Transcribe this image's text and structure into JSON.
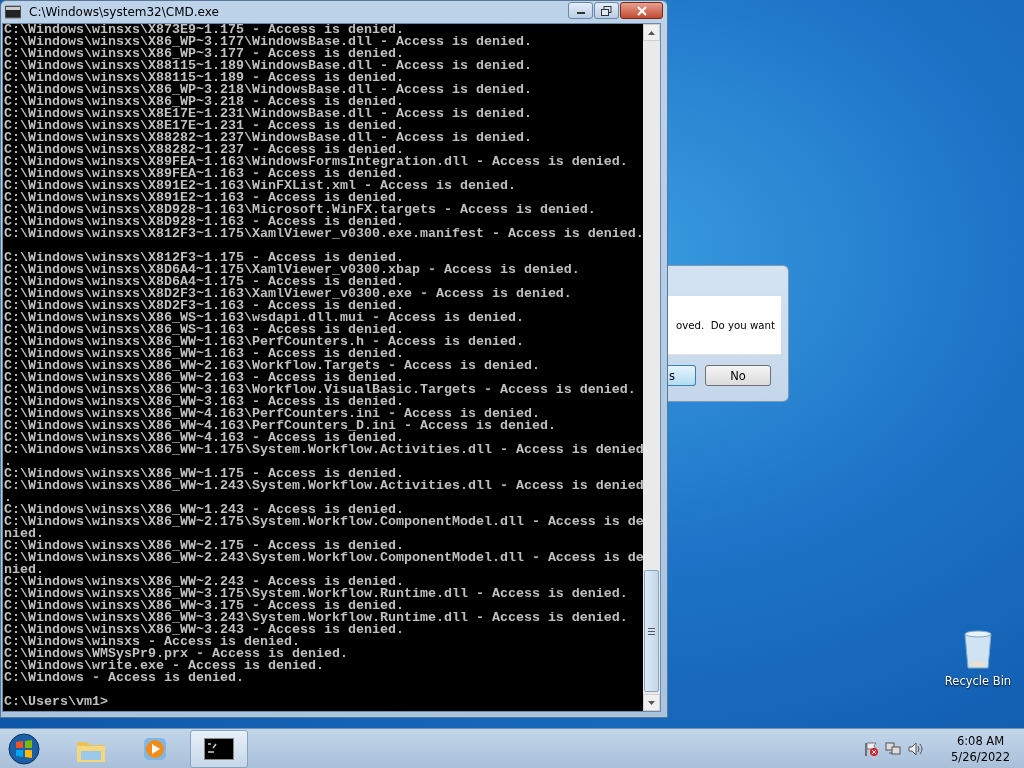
{
  "console_window": {
    "title": "C:\\Windows\\system32\\CMD.exe",
    "lines": [
      {
        "kind": "text",
        "text": "C:\\Windows\\winsxs\\X873E9~1.175 - Access is denied."
      },
      {
        "kind": "text",
        "text": "C:\\Windows\\winsxs\\X86_WP~3.177\\WindowsBase.dll - Access is denied."
      },
      {
        "kind": "text",
        "text": "C:\\Windows\\winsxs\\X86_WP~3.177 - Access is denied."
      },
      {
        "kind": "text",
        "text": "C:\\Windows\\winsxs\\X88115~1.189\\WindowsBase.dll - Access is denied."
      },
      {
        "kind": "text",
        "text": "C:\\Windows\\winsxs\\X88115~1.189 - Access is denied."
      },
      {
        "kind": "text",
        "text": "C:\\Windows\\winsxs\\X86_WP~3.218\\WindowsBase.dll - Access is denied."
      },
      {
        "kind": "text",
        "text": "C:\\Windows\\winsxs\\X86_WP~3.218 - Access is denied."
      },
      {
        "kind": "text",
        "text": "C:\\Windows\\winsxs\\X8E17E~1.231\\WindowsBase.dll - Access is denied."
      },
      {
        "kind": "text",
        "text": "C:\\Windows\\winsxs\\X8E17E~1.231 - Access is denied."
      },
      {
        "kind": "text",
        "text": "C:\\Windows\\winsxs\\X88282~1.237\\WindowsBase.dll - Access is denied."
      },
      {
        "kind": "text",
        "text": "C:\\Windows\\winsxs\\X88282~1.237 - Access is denied."
      },
      {
        "kind": "text",
        "text": "C:\\Windows\\winsxs\\X89FEA~1.163\\WindowsFormsIntegration.dll - Access is denied."
      },
      {
        "kind": "text",
        "text": "C:\\Windows\\winsxs\\X89FEA~1.163 - Access is denied."
      },
      {
        "kind": "text",
        "text": "C:\\Windows\\winsxs\\X891E2~1.163\\WinFXList.xml - Access is denied."
      },
      {
        "kind": "text",
        "text": "C:\\Windows\\winsxs\\X891E2~1.163 - Access is denied."
      },
      {
        "kind": "text",
        "text": "C:\\Windows\\winsxs\\X8D928~1.163\\Microsoft.WinFX.targets - Access is denied."
      },
      {
        "kind": "text",
        "text": "C:\\Windows\\winsxs\\X8D928~1.163 - Access is denied."
      },
      {
        "kind": "text",
        "text": "C:\\Windows\\winsxs\\X812F3~1.175\\XamlViewer_v0300.exe.manifest - Access is denied."
      },
      {
        "kind": "blank"
      },
      {
        "kind": "text",
        "text": "C:\\Windows\\winsxs\\X812F3~1.175 - Access is denied."
      },
      {
        "kind": "text",
        "text": "C:\\Windows\\winsxs\\X8D6A4~1.175\\XamlViewer_v0300.xbap - Access is denied."
      },
      {
        "kind": "text",
        "text": "C:\\Windows\\winsxs\\X8D6A4~1.175 - Access is denied."
      },
      {
        "kind": "text",
        "text": "C:\\Windows\\winsxs\\X8D2F3~1.163\\XamlViewer_v0300.exe - Access is denied."
      },
      {
        "kind": "text",
        "text": "C:\\Windows\\winsxs\\X8D2F3~1.163 - Access is denied."
      },
      {
        "kind": "text",
        "text": "C:\\Windows\\winsxs\\X86_WS~1.163\\wsdapi.dll.mui - Access is denied."
      },
      {
        "kind": "text",
        "text": "C:\\Windows\\winsxs\\X86_WS~1.163 - Access is denied."
      },
      {
        "kind": "text",
        "text": "C:\\Windows\\winsxs\\X86_WW~1.163\\PerfCounters.h - Access is denied."
      },
      {
        "kind": "text",
        "text": "C:\\Windows\\winsxs\\X86_WW~1.163 - Access is denied."
      },
      {
        "kind": "text",
        "text": "C:\\Windows\\winsxs\\X86_WW~2.163\\Workflow.Targets - Access is denied."
      },
      {
        "kind": "text",
        "text": "C:\\Windows\\winsxs\\X86_WW~2.163 - Access is denied."
      },
      {
        "kind": "text",
        "text": "C:\\Windows\\winsxs\\X86_WW~3.163\\Workflow.VisualBasic.Targets - Access is denied."
      },
      {
        "kind": "text",
        "text": "C:\\Windows\\winsxs\\X86_WW~3.163 - Access is denied."
      },
      {
        "kind": "text",
        "text": "C:\\Windows\\winsxs\\X86_WW~4.163\\PerfCounters.ini - Access is denied."
      },
      {
        "kind": "text",
        "text": "C:\\Windows\\winsxs\\X86_WW~4.163\\PerfCounters_D.ini - Access is denied."
      },
      {
        "kind": "text",
        "text": "C:\\Windows\\winsxs\\X86_WW~4.163 - Access is denied."
      },
      {
        "kind": "text",
        "text": "C:\\Windows\\winsxs\\X86_WW~1.175\\System.Workflow.Activities.dll - Access is denied"
      },
      {
        "kind": "text",
        "text": "."
      },
      {
        "kind": "text",
        "text": "C:\\Windows\\winsxs\\X86_WW~1.175 - Access is denied."
      },
      {
        "kind": "text",
        "text": "C:\\Windows\\winsxs\\X86_WW~1.243\\System.Workflow.Activities.dll - Access is denied"
      },
      {
        "kind": "text",
        "text": "."
      },
      {
        "kind": "text",
        "text": "C:\\Windows\\winsxs\\X86_WW~1.243 - Access is denied."
      },
      {
        "kind": "text",
        "text": "C:\\Windows\\winsxs\\X86_WW~2.175\\System.Workflow.ComponentModel.dll - Access is de"
      },
      {
        "kind": "text",
        "text": "nied."
      },
      {
        "kind": "text",
        "text": "C:\\Windows\\winsxs\\X86_WW~2.175 - Access is denied."
      },
      {
        "kind": "text",
        "text": "C:\\Windows\\winsxs\\X86_WW~2.243\\System.Workflow.ComponentModel.dll - Access is de"
      },
      {
        "kind": "text",
        "text": "nied."
      },
      {
        "kind": "text",
        "text": "C:\\Windows\\winsxs\\X86_WW~2.243 - Access is denied."
      },
      {
        "kind": "text",
        "text": "C:\\Windows\\winsxs\\X86_WW~3.175\\System.Workflow.Runtime.dll - Access is denied."
      },
      {
        "kind": "text",
        "text": "C:\\Windows\\winsxs\\X86_WW~3.175 - Access is denied."
      },
      {
        "kind": "text",
        "text": "C:\\Windows\\winsxs\\X86_WW~3.243\\System.Workflow.Runtime.dll - Access is denied."
      },
      {
        "kind": "text",
        "text": "C:\\Windows\\winsxs\\X86_WW~3.243 - Access is denied."
      },
      {
        "kind": "text",
        "text": "C:\\Windows\\winsxs - Access is denied."
      },
      {
        "kind": "text",
        "text": "C:\\Windows\\WMSysPr9.prx - Access is denied."
      },
      {
        "kind": "text",
        "text": "C:\\Windows\\write.exe - Access is denied."
      },
      {
        "kind": "text",
        "text": "C:\\Windows - Access is denied."
      },
      {
        "kind": "blank"
      },
      {
        "kind": "prompt",
        "text": "C:\\Users\\vm1>"
      }
    ]
  },
  "dialog": {
    "message": "oved.  Do you want",
    "buttons": [
      {
        "label": "s",
        "selected": true
      },
      {
        "label": "No",
        "selected": false
      }
    ]
  },
  "desktop_icons": [
    {
      "label": "Recycle Bin"
    }
  ],
  "taskbar": {
    "buttons": [
      {
        "kind": "folder",
        "selected": false
      },
      {
        "kind": "media",
        "selected": false
      },
      {
        "kind": "console",
        "selected": true
      }
    ],
    "clock": {
      "time": "6:08 AM",
      "date": "5/26/2022"
    }
  }
}
